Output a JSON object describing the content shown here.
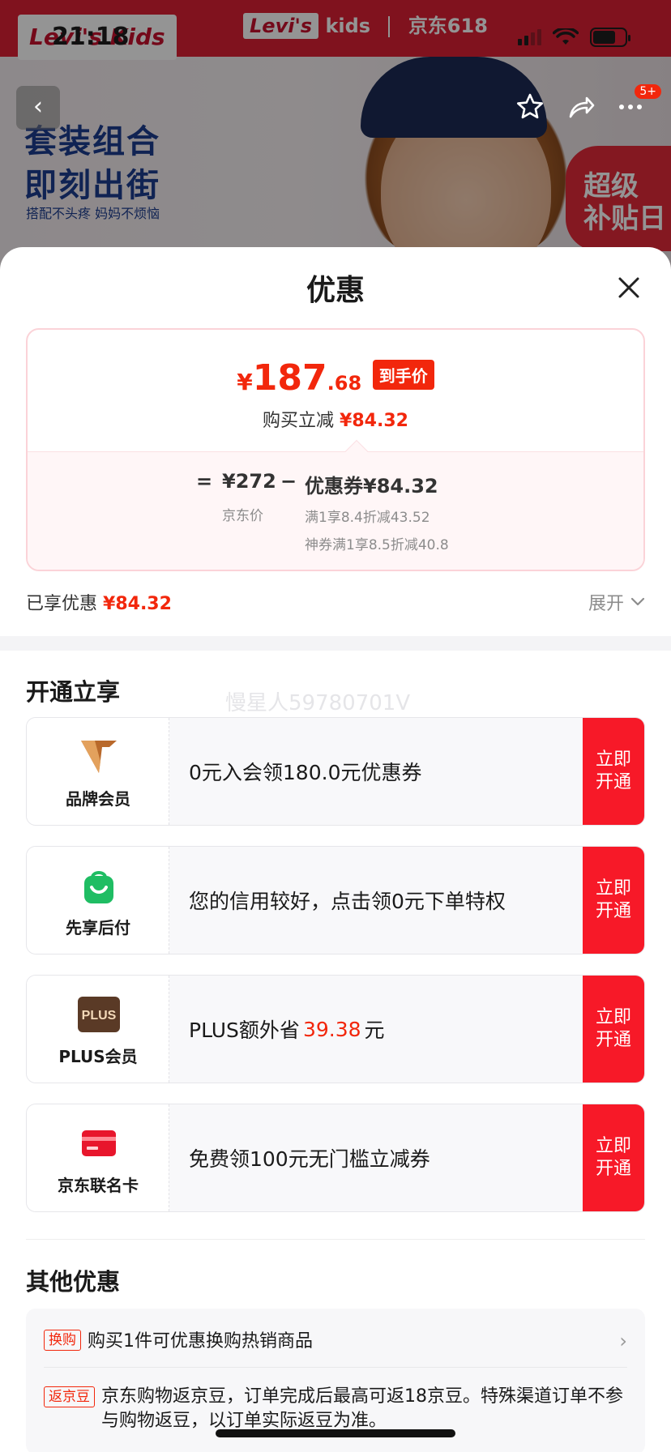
{
  "status_bar": {
    "time": "21:18"
  },
  "background": {
    "brand_left": "Levi's Kids",
    "brand_mid_logo": "Levi's",
    "brand_mid_kids": "kids",
    "brand_mid_partner": "京东618",
    "slogan_line1": "套装组合",
    "slogan_line2": "即刻出街",
    "slogan_sub": "搭配不头疼 妈妈不烦恼",
    "badge_line1": "超级",
    "badge_line2": "补贴日",
    "nav_badge": "5+"
  },
  "sheet": {
    "title": "优惠",
    "price": {
      "currency": "¥",
      "integer": "187",
      "decimal": ".68",
      "tag": "到手价",
      "sub_label": "购买立减",
      "sub_amount": "¥84.32"
    },
    "calc": {
      "equals": "=",
      "jd_price": "¥272",
      "jd_label": "京东价",
      "minus": "−",
      "coupon": "优惠券¥84.32",
      "coupon_detail1": "满1享8.4折减43.52",
      "coupon_detail2": "神券满1享8.5折减40.8"
    },
    "enjoyed_label": "已享优惠",
    "enjoyed_amount": "¥84.32",
    "expand_label": "展开",
    "watermark": "慢星人59780701V",
    "section_open": "开通立享",
    "members": [
      {
        "name": "品牌会员",
        "desc": "0元入会领180.0元优惠券",
        "button": "立即开通",
        "icon": "brand-member-icon"
      },
      {
        "name": "先享后付",
        "desc": "您的信用较好，点击领0元下单特权",
        "button": "立即开通",
        "icon": "pay-later-icon"
      },
      {
        "name": "PLUS会员",
        "desc_pre": "PLUS额外省",
        "desc_amount": "39.38",
        "desc_post": "元",
        "button": "立即开通",
        "icon": "plus-icon",
        "icon_text": "PLUS"
      },
      {
        "name": "京东联名卡",
        "desc": "免费领100元无门槛立减券",
        "button": "立即开通",
        "icon": "card-icon"
      }
    ],
    "section_other": "其他优惠",
    "other": [
      {
        "tag": "换购",
        "text": "购买1件可优惠换购热销商品"
      },
      {
        "tag": "返京豆",
        "text": "京东购物返京豆，订单完成后最高可返18京豆。特殊渠道订单不参与购物返豆，以订单实际返豆为准。"
      }
    ]
  },
  "colors": {
    "accent": "#f2270c",
    "button_red": "#f71928",
    "price_border": "#fbd3d8"
  }
}
